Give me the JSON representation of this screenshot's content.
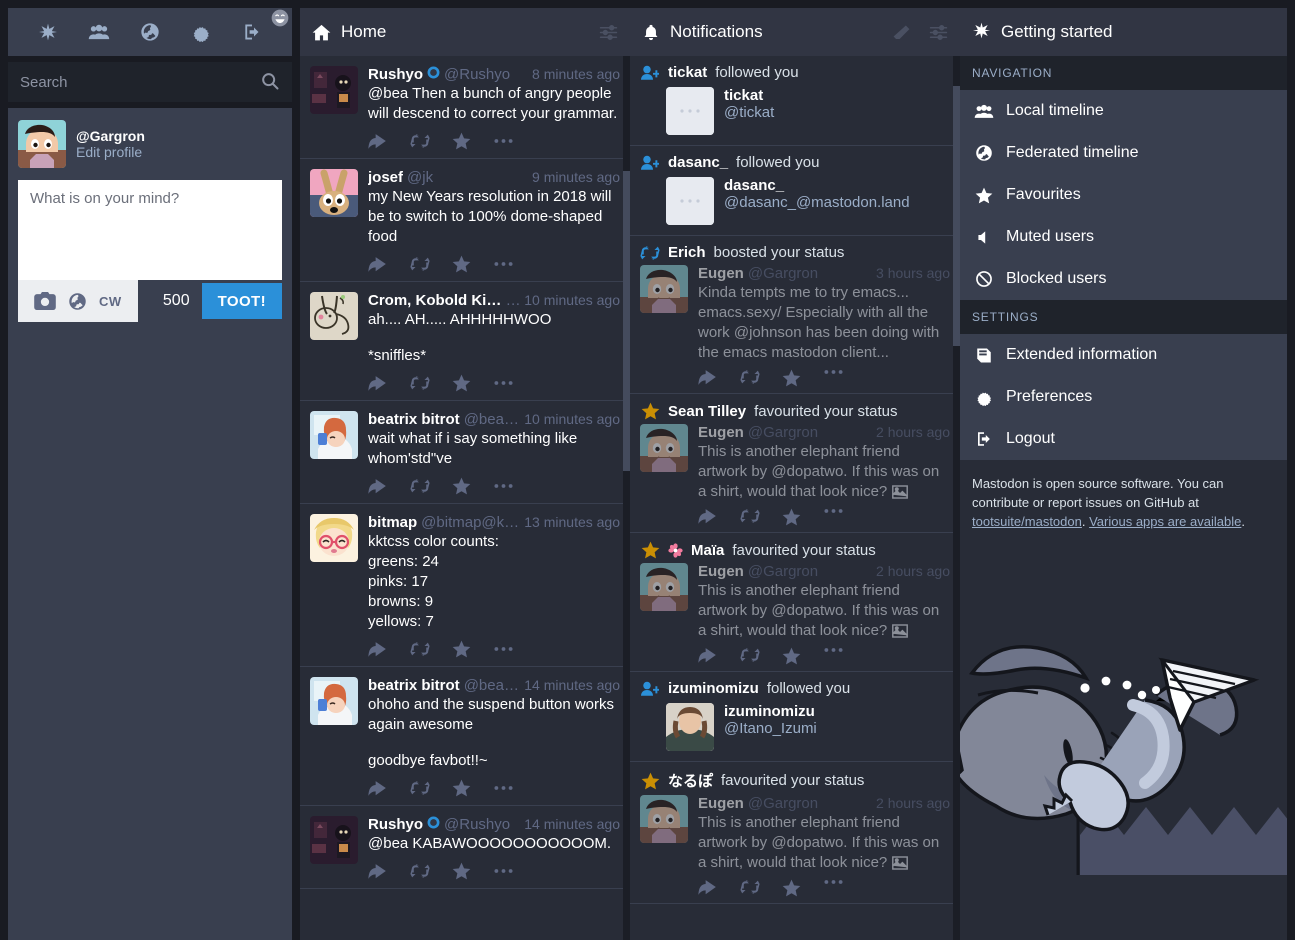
{
  "left_drawer": {
    "nav_icons": [
      "asterisk-icon",
      "community-icon",
      "globe-icon",
      "gear-icon",
      "logout-icon"
    ],
    "search": {
      "placeholder": "Search",
      "value": "",
      "icon": "search-icon"
    },
    "account": {
      "handle": "@Gargron",
      "edit_label": "Edit profile"
    },
    "composer": {
      "placeholder": "What is on your mind?",
      "value": "",
      "emoji_icon": "emoji-picker-icon",
      "tools": [
        "camera-icon",
        "globe-icon"
      ],
      "cw_label": "CW",
      "char_count": "500",
      "toot_label": "TOOT!",
      "accent": "#2b90d9"
    }
  },
  "home": {
    "title": "Home",
    "icon": "home-icon",
    "settings_icon": "sliders-icon",
    "statuses": [
      {
        "name": "Rushyo",
        "verified": true,
        "acct": "@Rushyo",
        "time": "8 minutes ago",
        "paragraphs": [
          "@bea Then a bunch of angry people will descend to correct your grammar."
        ],
        "avatar": "rushyo"
      },
      {
        "name": "josef",
        "verified": false,
        "acct": "@jk",
        "time": "9 minutes ago",
        "paragraphs": [
          "my New Years resolution in 2018 will be to switch to 100% dome-shaped food"
        ],
        "avatar": "josef"
      },
      {
        "name": "Crom, Kobold King",
        "verified": false,
        "acct": "…",
        "time": "10 minutes ago",
        "paragraphs": [
          "ah.... AH..... AHHHHHWOO",
          "*sniffles*"
        ],
        "avatar": "crom"
      },
      {
        "name": "beatrix bitrot",
        "verified": false,
        "acct": "@bea…",
        "time": "10 minutes ago",
        "paragraphs": [
          "wait what if i say something like whom'std\"ve"
        ],
        "avatar": "beatrix"
      },
      {
        "name": "bitmap",
        "verified": false,
        "acct": "@bitmap@k…",
        "time": "13 minutes ago",
        "paragraphs": [
          "kktcss color counts:\ngreens: 24\npinks: 17\nbrowns: 9\nyellows: 7"
        ],
        "avatar": "bitmap"
      },
      {
        "name": "beatrix bitrot",
        "verified": false,
        "acct": "@bea…",
        "time": "14 minutes ago",
        "paragraphs": [
          "ohoho and the suspend button works again awesome",
          "goodbye favbot!!~"
        ],
        "avatar": "beatrix"
      },
      {
        "name": "Rushyo",
        "verified": true,
        "acct": "@Rushyo",
        "time": "14 minutes ago",
        "paragraphs": [
          "@bea KABAWOOOOOOOOOOOM."
        ],
        "avatar": "rushyo"
      }
    ],
    "action_icons": [
      "reply-icon",
      "boost-icon",
      "favourite-icon",
      "more-icon"
    ]
  },
  "notifications": {
    "title": "Notifications",
    "icon": "bell-icon",
    "clear_icon": "eraser-icon",
    "settings_icon": "sliders-icon",
    "items": [
      {
        "type": "follow",
        "icon": "follow-icon",
        "actor": "tickat",
        "action": "followed you",
        "account_name": "tickat",
        "account_handle": "@tickat",
        "avatar": "blank"
      },
      {
        "type": "follow",
        "icon": "follow-icon",
        "actor": "dasanc_",
        "action": "followed you",
        "account_name": "dasanc_",
        "account_handle": "@dasanc_@mastodon.land",
        "avatar": "blank"
      },
      {
        "type": "boost",
        "icon": "boost-icon",
        "actor": "Erich",
        "action": "boosted your status",
        "status_name": "Eugen",
        "status_acct": "@Gargron",
        "status_time": "3 hours ago",
        "status_text": "Kinda tempts me to try emacs... emacs.sexy/ Especially with all the work @johnson has been doing with the emacs mastodon client...",
        "avatar": "gargron",
        "has_media": false
      },
      {
        "type": "favourite",
        "icon": "favourite-icon",
        "actor": "Sean Tilley",
        "action": "favourited your status",
        "status_name": "Eugen",
        "status_acct": "@Gargron",
        "status_time": "2 hours ago",
        "status_text": "This is another elephant friend artwork by @dopatwo. If this was on a shirt, would that look nice?",
        "avatar": "gargron",
        "has_media": true
      },
      {
        "type": "favourite",
        "icon": "favourite-icon",
        "emoji": "blossom-icon",
        "actor": "Maïa",
        "action": "favourited your status",
        "status_name": "Eugen",
        "status_acct": "@Gargron",
        "status_time": "2 hours ago",
        "status_text": "This is another elephant friend artwork by @dopatwo. If this was on a shirt, would that look nice?",
        "avatar": "gargron",
        "has_media": true
      },
      {
        "type": "follow",
        "icon": "follow-icon",
        "actor": "izuminomizu",
        "action": "followed you",
        "account_name": "izuminomizu",
        "account_handle": "@Itano_Izumi",
        "avatar": "izumi"
      },
      {
        "type": "favourite",
        "icon": "favourite-icon",
        "actor": "なるぽ",
        "action": "favourited your status",
        "status_name": "Eugen",
        "status_acct": "@Gargron",
        "status_time": "2 hours ago",
        "status_text": "This is another elephant friend artwork by @dopatwo. If this was on a shirt, would that look nice?",
        "avatar": "gargron",
        "has_media": true
      }
    ]
  },
  "right_sidebar": {
    "title": "Getting started",
    "icon": "asterisk-icon",
    "navigation_heading": "NAVIGATION",
    "navigation": [
      {
        "label": "Local timeline",
        "icon": "community-icon"
      },
      {
        "label": "Federated timeline",
        "icon": "globe-icon"
      },
      {
        "label": "Favourites",
        "icon": "star-icon"
      },
      {
        "label": "Muted users",
        "icon": "mute-icon"
      },
      {
        "label": "Blocked users",
        "icon": "block-icon"
      }
    ],
    "settings_heading": "SETTINGS",
    "settings": [
      {
        "label": "Extended information",
        "icon": "book-icon"
      },
      {
        "label": "Preferences",
        "icon": "gear-icon"
      },
      {
        "label": "Logout",
        "icon": "logout-icon"
      }
    ],
    "note_text_1": "Mastodon is open source software. You can contribute or report issues on GitHub at ",
    "note_link_1": "tootsuite/mastodon",
    "note_text_2": ". ",
    "note_link_2": "Various apps are available",
    "note_text_3": ".",
    "illustration": "mastodon-elephant-paper-plane"
  }
}
